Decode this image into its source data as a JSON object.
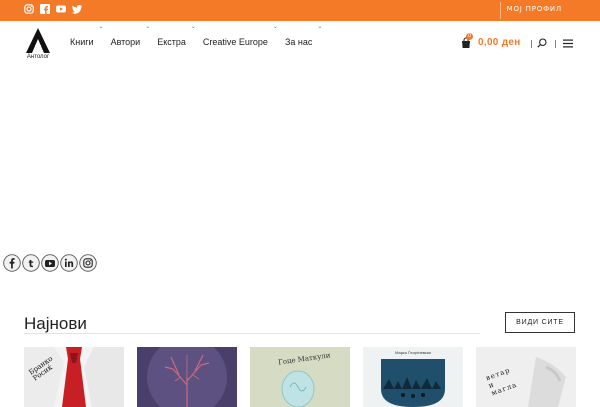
{
  "topbar": {
    "profile_label": "МОЈ ПРОФИЛ",
    "social_icons": [
      "instagram-icon",
      "facebook-icon",
      "youtube-icon",
      "twitter-icon"
    ],
    "color": "#f47a27"
  },
  "header": {
    "logo_text": "Антолог",
    "nav": [
      {
        "label": "Книги"
      },
      {
        "label": "Автори"
      },
      {
        "label": "Екстра"
      },
      {
        "label": "Creative Europe"
      },
      {
        "label": "За нас"
      }
    ],
    "cart_count": "0",
    "cart_total": "0,00 ден",
    "accent": "#f47a27"
  },
  "floating_social": [
    "facebook-icon",
    "twitter-icon",
    "youtube-icon",
    "linkedin-icon",
    "instagram-icon"
  ],
  "latest": {
    "title": "Најнови",
    "view_all": "ВИДИ СИТЕ",
    "books": [
      {
        "cover_text": "Бранко Росиќ"
      },
      {
        "cover_text": ""
      },
      {
        "cover_text": "Гоце Маткули"
      },
      {
        "cover_text": "Марко Ѓеорѓиевски"
      },
      {
        "cover_text": "ветар и магла"
      }
    ]
  }
}
